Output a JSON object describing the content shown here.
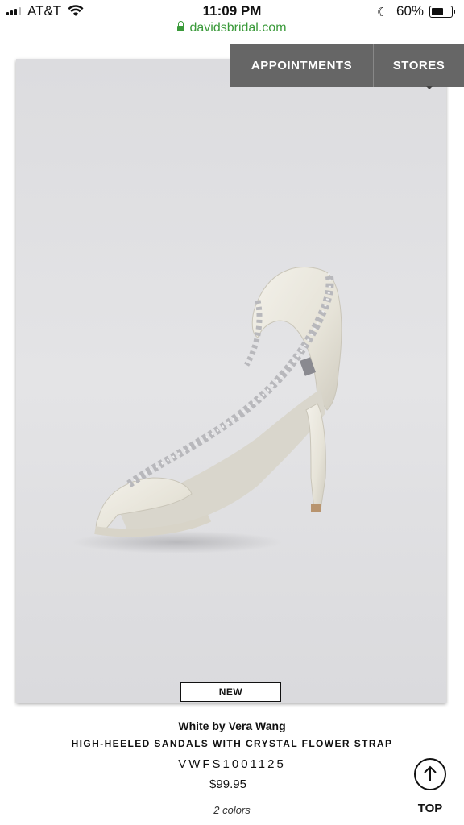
{
  "status_bar": {
    "carrier": "AT&T",
    "time": "11:09 PM",
    "battery_percent": "60%",
    "battery_level": 0.6,
    "signal_bars": 3,
    "signal_max": 4,
    "icons": [
      "signal-icon",
      "wifi-icon",
      "moon-icon",
      "battery-icon"
    ]
  },
  "browser": {
    "url": "davidsbridal.com",
    "url_color": "#3a9a3a",
    "icon": "lock-icon"
  },
  "nav": {
    "appointments_label": "APPOINTMENTS",
    "stores_label": "STORES",
    "background": "#666666"
  },
  "product": {
    "badge": "NEW",
    "brand": "White by Vera Wang",
    "name": "HIGH-HEELED SANDALS WITH CRYSTAL FLOWER STRAP",
    "sku": "VWFS1001125",
    "price": "$99.95",
    "colors_count": "2 colors",
    "image_icon": "shoe-image"
  },
  "top_button": {
    "label": "TOP",
    "icon": "arrow-up-circle-icon"
  }
}
